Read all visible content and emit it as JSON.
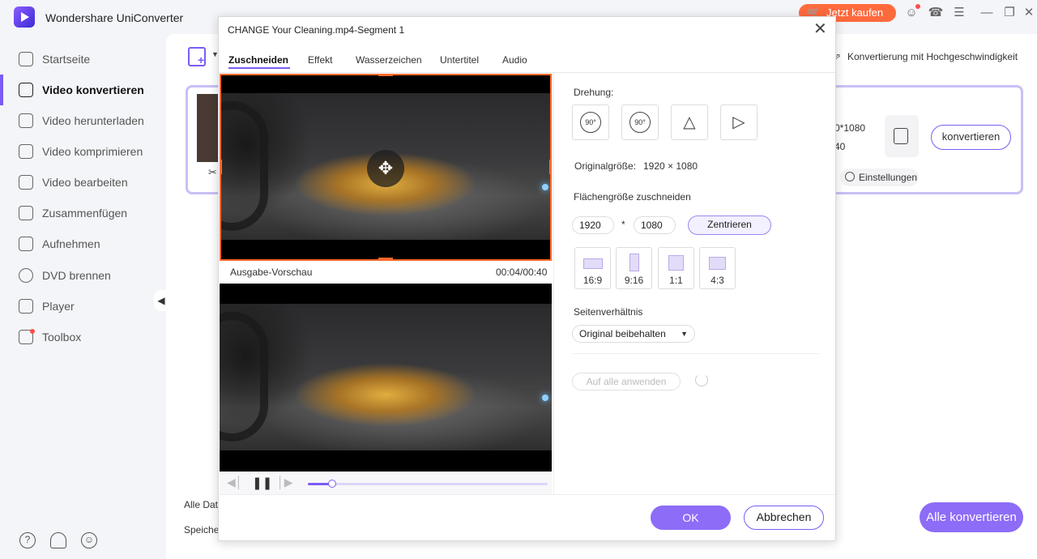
{
  "app": {
    "title": "Wondershare UniConverter",
    "buy_label": "Jetzt kaufen",
    "accent_color": "#7b5cf5",
    "buy_color": "#ff6a3d"
  },
  "sidebar": {
    "items": [
      {
        "label": "Startseite",
        "icon": "home-icon"
      },
      {
        "label": "Video konvertieren",
        "icon": "convert-icon",
        "active": true
      },
      {
        "label": "Video herunterladen",
        "icon": "download-icon"
      },
      {
        "label": "Video komprimieren",
        "icon": "compress-icon"
      },
      {
        "label": "Video bearbeiten",
        "icon": "scissors-icon"
      },
      {
        "label": "Zusammenfügen",
        "icon": "merge-icon"
      },
      {
        "label": "Aufnehmen",
        "icon": "record-icon"
      },
      {
        "label": "DVD brennen",
        "icon": "dvd-icon"
      },
      {
        "label": "Player",
        "icon": "play-icon"
      },
      {
        "label": "Toolbox",
        "icon": "toolbox-icon"
      }
    ]
  },
  "main": {
    "speed_label": "Konvertierung mit Hochgeschwindigkeit",
    "card": {
      "resolution_partial": "0*1080",
      "resolution_partial_2": "40",
      "convert_label": "konvertieren",
      "settings_label": "Einstellungen"
    },
    "bottom_1": "Alle Dat",
    "bottom_2": "Speiche",
    "all_convert_label": "Alle konvertieren"
  },
  "dialog": {
    "title": "CHANGE Your Cleaning.mp4-Segment 1",
    "tabs": [
      "Zuschneiden",
      "Effekt",
      "Wasserzeichen",
      "Untertitel",
      "Audio"
    ],
    "active_tab": 0,
    "preview_label": "Ausgabe-Vorschau",
    "time": "00:04/00:40",
    "progress": 0.1,
    "rotation_label": "Drehung:",
    "rotate_cw_label": "90°",
    "rotate_ccw_label": "90°",
    "original_size_label": "Originalgröße:",
    "original_size_value": "1920 × 1080",
    "crop_area_label": "Flächengröße zuschneiden",
    "crop_width": "1920",
    "crop_height": "1080",
    "times_sign": "*",
    "center_label": "Zentrieren",
    "ratios": [
      "16:9",
      "9:16",
      "1:1",
      "4:3"
    ],
    "aspect_label": "Seitenverhältnis",
    "aspect_value": "Original beibehalten",
    "apply_all_label": "Auf alle anwenden",
    "ok_label": "OK",
    "cancel_label": "Abbrechen"
  }
}
